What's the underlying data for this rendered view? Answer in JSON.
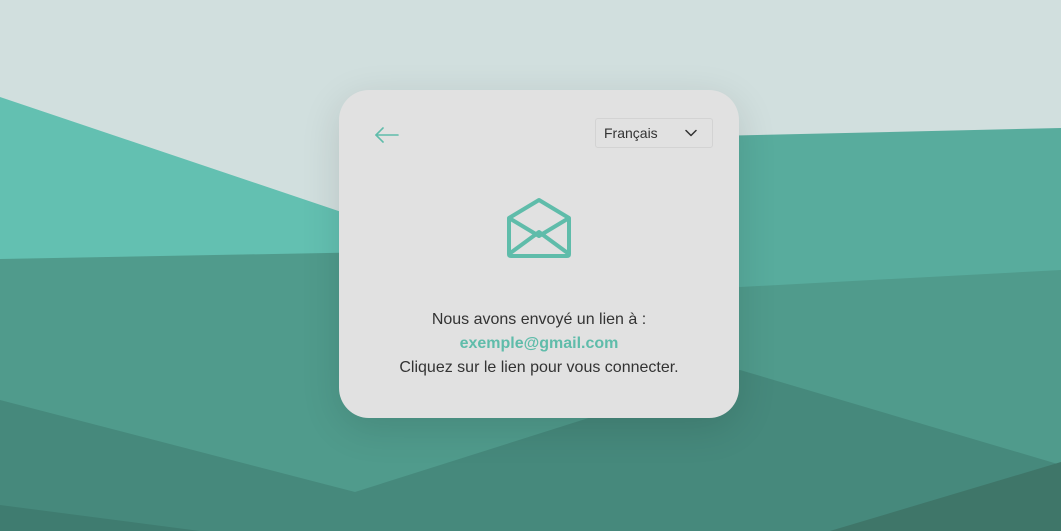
{
  "language": {
    "selected": "Français"
  },
  "confirmation": {
    "line1": "Nous avons envoyé un lien à :",
    "email": "exemple@gmail.com",
    "line3": "Cliquez sur le lien pour vous connecter."
  },
  "icons": {
    "back": "arrow-left-icon",
    "chevron": "chevron-down-icon",
    "envelope": "envelope-open-icon"
  },
  "colors": {
    "accent": "#5fbcaa",
    "card_bg": "#e1e1e1",
    "sky": "#d0dfdd",
    "hill_light": "#63c0b0",
    "hill_mid": "#58ac9c",
    "hill_dark": "#4f9a8c",
    "hill_darker": "#458a7d"
  }
}
